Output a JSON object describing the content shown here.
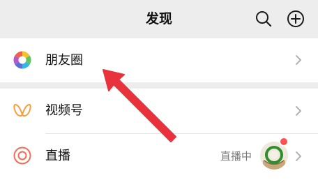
{
  "header": {
    "title": "发现",
    "search_icon": "search-icon",
    "add_icon": "plus-circle-icon"
  },
  "items": [
    {
      "label": "朋友圈",
      "icon": "moments-aperture-icon"
    },
    {
      "label": "视频号",
      "icon": "channels-butterfly-icon",
      "icon_color": "#fa9d3b"
    },
    {
      "label": "直播",
      "icon": "live-rings-icon",
      "icon_color": "#f36c58",
      "status_text": "直播中"
    }
  ],
  "colors": {
    "background": "#ededed",
    "card": "#ffffff",
    "annotation_arrow": "#e8323c",
    "badge_dot": "#fa5151"
  }
}
